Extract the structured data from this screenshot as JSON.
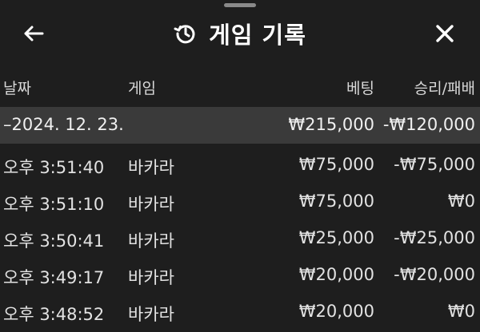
{
  "header": {
    "title": "게임 기록",
    "back_icon": "arrow-left-icon",
    "history_icon": "history-icon",
    "close_icon": "close-icon"
  },
  "columns": {
    "date": "날짜",
    "game": "게임",
    "bet": "베팅",
    "result": "승리/패배"
  },
  "group": {
    "date": "–2024. 12. 23.",
    "bet_total": "₩215,000",
    "result_total": "-₩120,000"
  },
  "rows": [
    {
      "time": "오후 3:51:40",
      "game": "바카라",
      "bet": "₩75,000",
      "result": "-₩75,000"
    },
    {
      "time": "오후 3:51:10",
      "game": "바카라",
      "bet": "₩75,000",
      "result": "₩0"
    },
    {
      "time": "오후 3:50:41",
      "game": "바카라",
      "bet": "₩25,000",
      "result": "-₩25,000"
    },
    {
      "time": "오후 3:49:17",
      "game": "바카라",
      "bet": "₩20,000",
      "result": "-₩20,000"
    },
    {
      "time": "오후 3:48:52",
      "game": "바카라",
      "bet": "₩20,000",
      "result": "₩0"
    }
  ]
}
